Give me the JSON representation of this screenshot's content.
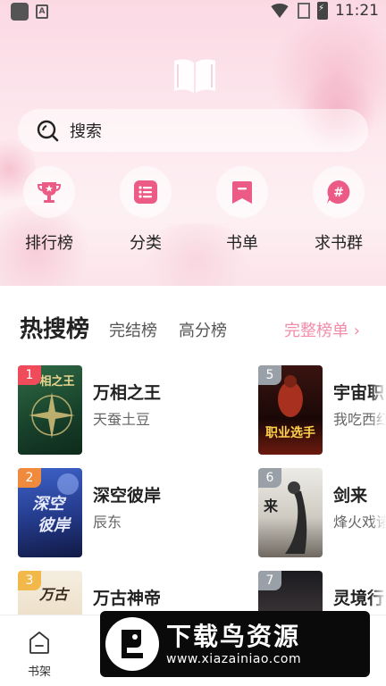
{
  "status_bar": {
    "time": "11:21"
  },
  "search": {
    "label": "搜索"
  },
  "actions": [
    {
      "label": "排行榜",
      "icon": "trophy-icon"
    },
    {
      "label": "分类",
      "icon": "list-icon"
    },
    {
      "label": "书单",
      "icon": "bookmark-icon"
    },
    {
      "label": "求书群",
      "icon": "hashtag-chat-icon"
    }
  ],
  "rankings": {
    "tabs": [
      "热搜榜",
      "完结榜",
      "高分榜"
    ],
    "more": "完整榜单 ›",
    "books": [
      {
        "rank": "1",
        "title": "万相之王",
        "author": "天蚕土豆"
      },
      {
        "rank": "2",
        "title": "深空彼岸",
        "author": "辰东"
      },
      {
        "rank": "3",
        "title": "万古神帝",
        "author": ""
      },
      {
        "rank": "5",
        "title": "宇宙职",
        "author": "我吃西红"
      },
      {
        "rank": "6",
        "title": "剑来",
        "author": "烽火戏诸"
      },
      {
        "rank": "7",
        "title": "灵境行",
        "author": ""
      }
    ]
  },
  "bottom_nav": {
    "shelf": "书架"
  },
  "watermark": {
    "name": "下载鸟资源",
    "url": "www.xiazainiao.com"
  },
  "colors": {
    "accent": "#f28da9",
    "brand_pink": "#ec5b86"
  }
}
